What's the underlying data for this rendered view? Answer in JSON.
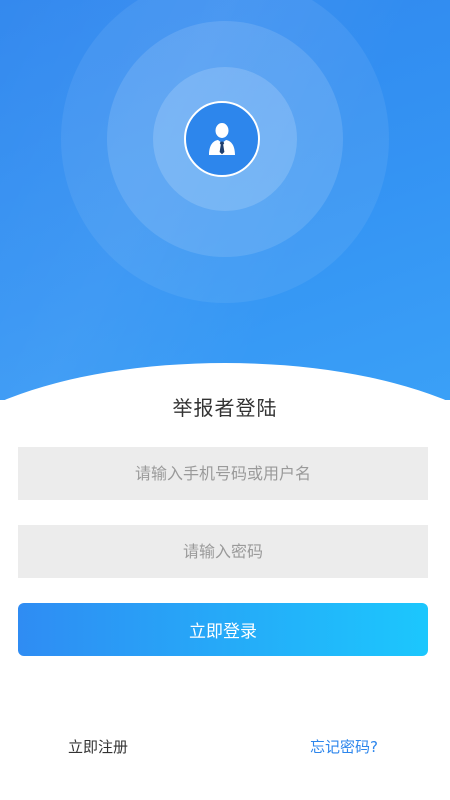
{
  "header": {
    "avatar_icon": "user-businessman-icon",
    "colors": {
      "primary": "#2f86ee",
      "accent_end": "#1cc7fd"
    }
  },
  "login": {
    "title": "举报者登陆",
    "username": {
      "placeholder": "请输入手机号码或用户名",
      "value": ""
    },
    "password": {
      "placeholder": "请输入密码",
      "value": ""
    },
    "submit_label": "立即登录"
  },
  "footer": {
    "register_label": "立即注册",
    "forgot_label": "忘记密码?"
  }
}
